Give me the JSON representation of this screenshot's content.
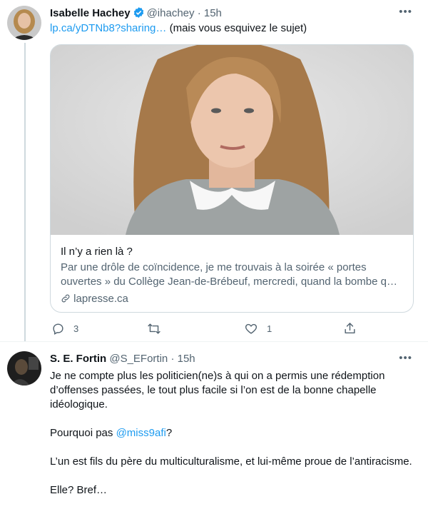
{
  "tweets": [
    {
      "display_name": "Isabelle Hachey",
      "handle": "@ihachey",
      "separator": "·",
      "time": "15h",
      "more": "•••",
      "link_text": "lp.ca/yDTNb8?sharing…",
      "text_after_link": "(mais vous esquivez le sujet)",
      "card": {
        "title": "Il n’y a rien là ?",
        "description": "Par une drôle de coïncidence, je me trouvais à la soirée « portes ouvertes » du Collège Jean-de-Brébeuf, mercredi, quand la bombe q…",
        "domain": "lapresse.ca"
      },
      "actions": {
        "reply_icon": "reply-icon",
        "reply_count": "3",
        "retweet_icon": "retweet-icon",
        "retweet_count": "",
        "like_icon": "heart-icon",
        "like_count": "1",
        "share_icon": "share-icon"
      },
      "colors": {
        "link": "#1d9bf0",
        "verified": "#1d9bf0"
      }
    },
    {
      "display_name": "S. E. Fortin",
      "handle": "@S_EFortin",
      "separator": "·",
      "time": "15h",
      "more": "•••",
      "paragraph1": "Je ne compte plus les politicien(ne)s à qui on a permis une rédemption d’offenses passées, le tout plus facile si l’on est de la bonne chapelle idéologique.",
      "paragraph2_prefix": "Pourquoi pas ",
      "paragraph2_mention": "@miss9afi",
      "paragraph2_suffix": "?",
      "paragraph3": "L’un est fils du père du multiculturalisme, et lui-même proue de l’antiracisme.",
      "paragraph4": "Elle? Bref…"
    }
  ]
}
